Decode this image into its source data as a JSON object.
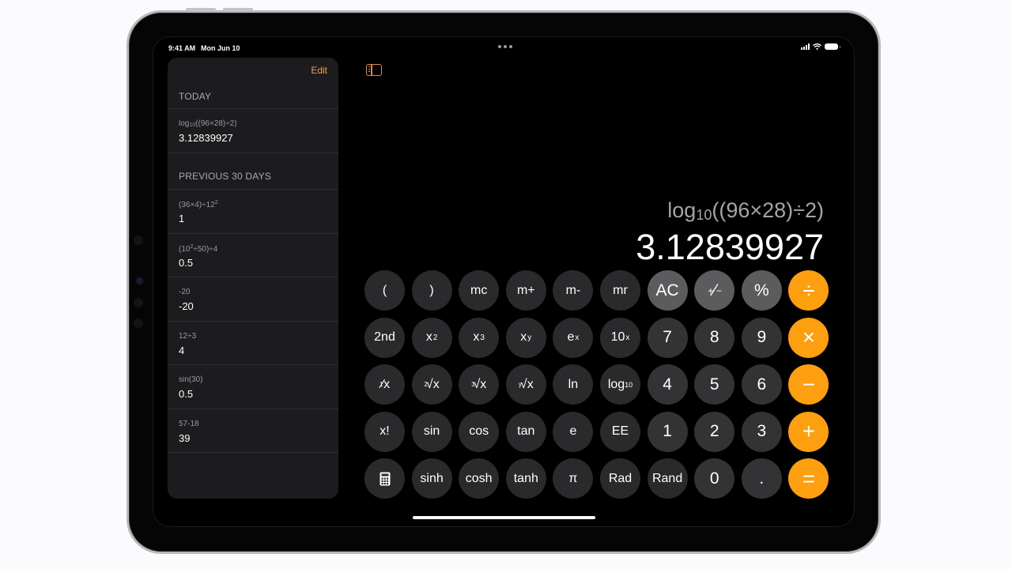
{
  "status_bar": {
    "time": "9:41 AM",
    "date": "Mon Jun 10",
    "icons": [
      "cellular-signal-icon",
      "wifi-icon",
      "battery-icon"
    ]
  },
  "multitasking_icon": "more-dots-icon",
  "sidebar_toggle_icon": "sidebar-icon",
  "accent_color": "#fd9f0f",
  "history": {
    "edit_label": "Edit",
    "sections": [
      {
        "header": "TODAY",
        "items": [
          {
            "expression_html": "log<sub>10</sub>((96×28)÷2)",
            "result": "3.12839927"
          }
        ]
      },
      {
        "header": "PREVIOUS 30 DAYS",
        "items": [
          {
            "expression_html": "(36×4)÷12<sup>2</sup>",
            "result": "1"
          },
          {
            "expression_html": "(10<sup>2</sup>÷50)÷4",
            "result": "0.5"
          },
          {
            "expression_html": "-20",
            "result": "-20"
          },
          {
            "expression_html": "12÷3",
            "result": "4"
          },
          {
            "expression_html": "sin(30)",
            "result": "0.5"
          },
          {
            "expression_html": "57-18",
            "result": "39"
          }
        ]
      }
    ]
  },
  "display": {
    "expression_html": "log<sub>10</sub>((96×28)÷2)",
    "result": "3.12839927"
  },
  "keypad": {
    "rows": [
      [
        {
          "label": "(",
          "name": "open-paren-key",
          "type": "sci"
        },
        {
          "label": ")",
          "name": "close-paren-key",
          "type": "sci"
        },
        {
          "label": "mc",
          "name": "memory-clear-key",
          "type": "sci"
        },
        {
          "label": "m+",
          "name": "memory-add-key",
          "type": "sci"
        },
        {
          "label": "m-",
          "name": "memory-subtract-key",
          "type": "sci"
        },
        {
          "label": "mr",
          "name": "memory-recall-key",
          "type": "sci"
        },
        {
          "label": "AC",
          "name": "all-clear-key",
          "type": "fn"
        },
        {
          "label_html": "<sup style='font-size:12px;vertical-align:6px'>+</sup>⁄<sub style='font-size:12px'>−</sub>",
          "name": "plus-minus-key",
          "type": "fn"
        },
        {
          "label": "%",
          "name": "percent-key",
          "type": "fn"
        },
        {
          "label": "÷",
          "name": "divide-key",
          "type": "op"
        }
      ],
      [
        {
          "label": "2nd",
          "name": "second-key",
          "type": "sci"
        },
        {
          "label_html": "x<sup>2</sup>",
          "name": "square-key",
          "type": "sci"
        },
        {
          "label_html": "x<sup>3</sup>",
          "name": "cube-key",
          "type": "sci"
        },
        {
          "label_html": "x<sup>y</sup>",
          "name": "power-key",
          "type": "sci"
        },
        {
          "label_html": "e<sup>x</sup>",
          "name": "exp-key",
          "type": "sci"
        },
        {
          "label_html": "10<sup>x</sup>",
          "name": "ten-power-key",
          "type": "sci"
        },
        {
          "label": "7",
          "name": "digit-7-key",
          "type": "num"
        },
        {
          "label": "8",
          "name": "digit-8-key",
          "type": "num"
        },
        {
          "label": "9",
          "name": "digit-9-key",
          "type": "num"
        },
        {
          "label": "×",
          "name": "multiply-key",
          "type": "op"
        }
      ],
      [
        {
          "label_html": "<span class='pre'>1</span>⁄x",
          "name": "reciprocal-key",
          "type": "sci"
        },
        {
          "label_html": "<span class='pre'>2</span>√x",
          "name": "square-root-key",
          "type": "sci"
        },
        {
          "label_html": "<span class='pre'>3</span>√x",
          "name": "cube-root-key",
          "type": "sci"
        },
        {
          "label_html": "<span class='pre'>y</span>√x",
          "name": "y-root-key",
          "type": "sci"
        },
        {
          "label": "ln",
          "name": "natural-log-key",
          "type": "sci"
        },
        {
          "label_html": "log<sub>10</sub>",
          "name": "log10-key",
          "type": "sci"
        },
        {
          "label": "4",
          "name": "digit-4-key",
          "type": "num"
        },
        {
          "label": "5",
          "name": "digit-5-key",
          "type": "num"
        },
        {
          "label": "6",
          "name": "digit-6-key",
          "type": "num"
        },
        {
          "label": "−",
          "name": "subtract-key",
          "type": "op"
        }
      ],
      [
        {
          "label": "x!",
          "name": "factorial-key",
          "type": "sci"
        },
        {
          "label": "sin",
          "name": "sin-key",
          "type": "sci"
        },
        {
          "label": "cos",
          "name": "cos-key",
          "type": "sci"
        },
        {
          "label": "tan",
          "name": "tan-key",
          "type": "sci"
        },
        {
          "label": "e",
          "name": "euler-key",
          "type": "sci"
        },
        {
          "label": "EE",
          "name": "ee-key",
          "type": "sci"
        },
        {
          "label": "1",
          "name": "digit-1-key",
          "type": "num"
        },
        {
          "label": "2",
          "name": "digit-2-key",
          "type": "num"
        },
        {
          "label": "3",
          "name": "digit-3-key",
          "type": "num"
        },
        {
          "label": "+",
          "name": "add-key",
          "type": "op"
        }
      ],
      [
        {
          "icon": "calculator-icon",
          "name": "calculator-mode-key",
          "type": "sci"
        },
        {
          "label": "sinh",
          "name": "sinh-key",
          "type": "sci"
        },
        {
          "label": "cosh",
          "name": "cosh-key",
          "type": "sci"
        },
        {
          "label": "tanh",
          "name": "tanh-key",
          "type": "sci"
        },
        {
          "label": "π",
          "name": "pi-key",
          "type": "sci"
        },
        {
          "label": "Rad",
          "name": "rad-key",
          "type": "sci"
        },
        {
          "label": "Rand",
          "name": "rand-key",
          "type": "sci"
        },
        {
          "label": "0",
          "name": "digit-0-key",
          "type": "num"
        },
        {
          "label": ".",
          "name": "decimal-key",
          "type": "num"
        },
        {
          "label": "=",
          "name": "equals-key",
          "type": "op"
        }
      ]
    ]
  }
}
